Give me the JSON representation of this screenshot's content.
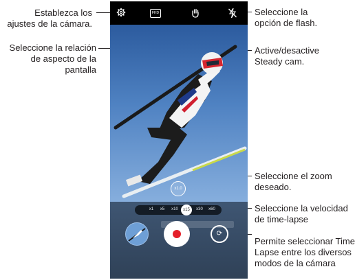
{
  "labels": {
    "settings": "Establezca los ajustes de la cámara.",
    "aspect_ratio": "Seleccione la relación de aspecto de la pantalla",
    "flash": "Seleccione la opción de flash.",
    "steady_cam": "Active/desactive Steady cam.",
    "zoom": "Seleccione el zoom deseado.",
    "speed": "Seleccione la velocidad de time-lapse",
    "mode_prefix": "Permite seleccionar",
    "mode_name": "Time Lapse",
    "mode_suffix": "entre los diversos modos de la cámara"
  },
  "screen": {
    "top_icons": [
      "gear-icon",
      "aspect-ratio-icon",
      "steady-cam-icon",
      "flash-off-icon"
    ],
    "aspect_ratio_text": "FHD",
    "zoom_value": "x1.0",
    "speeds": [
      "x1",
      "x5",
      "x10",
      "x15",
      "x30",
      "x60"
    ],
    "selected_speed": "x15",
    "colors": {
      "record": "#e4202a",
      "sky": "#4f82c2",
      "bottom_panel": "#344a63"
    }
  }
}
